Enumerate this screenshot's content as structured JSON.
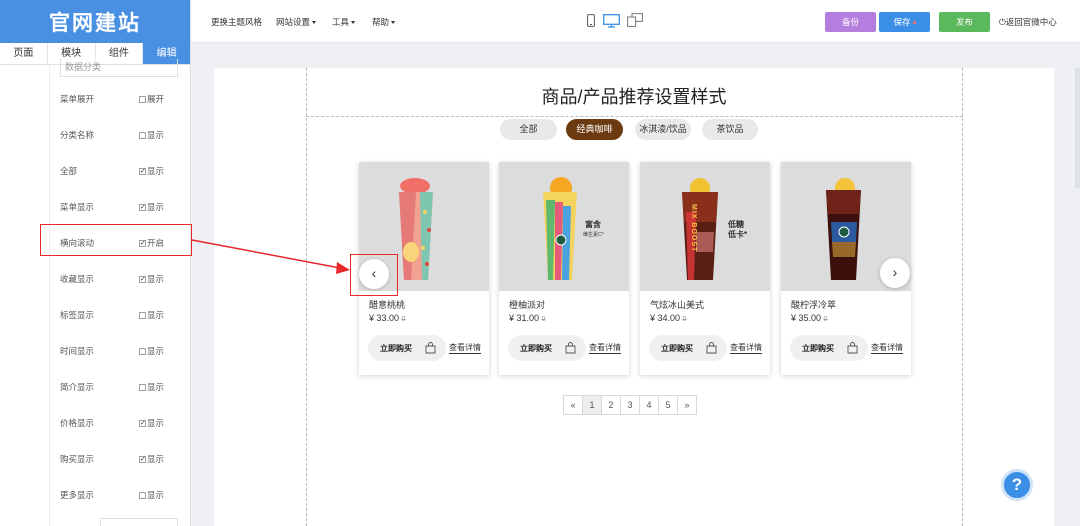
{
  "app": {
    "logo": "官网建站"
  },
  "sidebar": {
    "tabs": [
      {
        "label": "页面"
      },
      {
        "label": "模块"
      },
      {
        "label": "组件"
      },
      {
        "label": "编辑"
      }
    ],
    "partial_input_text": "数据分类",
    "options": [
      {
        "label": "菜单展开",
        "checked": false,
        "check_label": "展开"
      },
      {
        "label": "分类名称",
        "checked": false,
        "check_label": "显示"
      },
      {
        "label": "全部",
        "checked": true,
        "check_label": "显示"
      },
      {
        "label": "菜单显示",
        "checked": true,
        "check_label": "显示"
      },
      {
        "label": "横向滚动",
        "checked": true,
        "check_label": "开启"
      },
      {
        "label": "收藏显示",
        "checked": true,
        "check_label": "显示"
      },
      {
        "label": "标签显示",
        "checked": false,
        "check_label": "显示"
      },
      {
        "label": "时间显示",
        "checked": false,
        "check_label": "显示"
      },
      {
        "label": "简介显示",
        "checked": false,
        "check_label": "显示"
      },
      {
        "label": "价格显示",
        "checked": true,
        "check_label": "显示"
      },
      {
        "label": "购买显示",
        "checked": true,
        "check_label": "显示"
      },
      {
        "label": "更多显示",
        "checked": false,
        "check_label": "显示"
      }
    ]
  },
  "topbar": {
    "menus": [
      "更换主题风格",
      "网站设置",
      "工具",
      "帮助"
    ],
    "backup_label": "备份",
    "save_label": "保存",
    "publish_label": "发布",
    "back_label": "返回官微中心",
    "colors": {
      "backup": "#b57ddd",
      "save": "#3b8ee6",
      "publish": "#5cb85c",
      "device_active": "#3b8ee6"
    }
  },
  "section": {
    "title": "商品/产品推荐设置样式",
    "categories": [
      "全部",
      "经典咖啡",
      "冰淇淩/饮品",
      "茶饮品"
    ],
    "active_category": "经典咖啡",
    "products": [
      {
        "name": "醋意桃桃",
        "price": "¥ 33.00",
        "old_price": "0",
        "buy_label": "立即购买",
        "detail_label": "查看详情"
      },
      {
        "name": "橙柚派对",
        "price": "¥ 31.00",
        "old_price": "0",
        "buy_label": "立即购买",
        "detail_label": "查看详情"
      },
      {
        "name": "气炫冰山美式",
        "price": "¥ 34.00",
        "old_price": "0",
        "buy_label": "立即购买",
        "detail_label": "查看详情"
      },
      {
        "name": "酸柠浮冷萃",
        "price": "¥ 35.00",
        "old_price": "0",
        "buy_label": "立即购买",
        "detail_label": "查看详情"
      }
    ],
    "cup_texts": [
      "富含",
      "维生素C*",
      "低糖",
      "低卡*",
      "MIX BOOST"
    ],
    "prev_arrow": "‹",
    "next_arrow": "›",
    "pagination": [
      "«",
      "1",
      "2",
      "3",
      "4",
      "5",
      "»"
    ],
    "active_page": "1"
  },
  "help_label": "?"
}
